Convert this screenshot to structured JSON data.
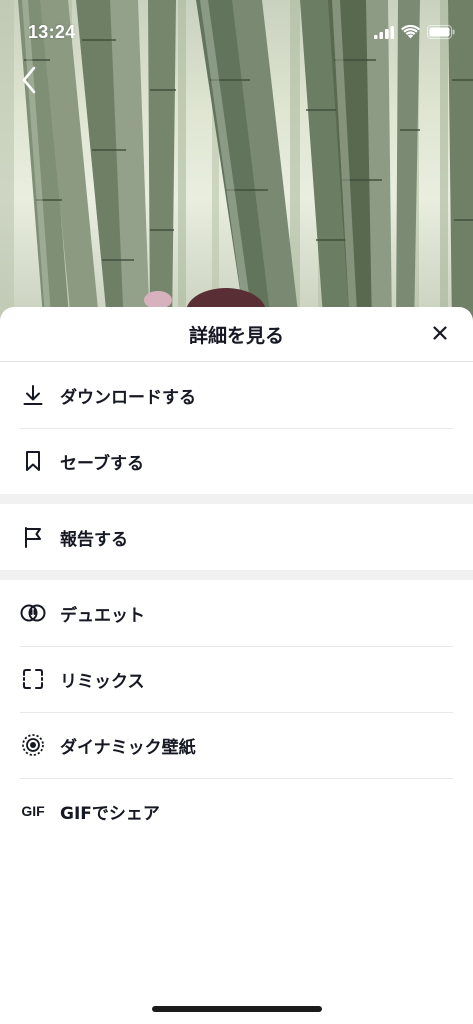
{
  "status_bar": {
    "time": "13:24",
    "icons": [
      "cellular-signal-icon",
      "wifi-icon",
      "battery-icon"
    ]
  },
  "photo": {
    "description_icon": "bamboo-grove-photo"
  },
  "nav": {
    "back_icon": "chevron-left-icon"
  },
  "sheet": {
    "title": "詳細を見る",
    "close_icon": "close-icon",
    "groups": [
      {
        "items": [
          {
            "label": "ダウンロードする",
            "icon": "download-icon"
          },
          {
            "label": "セーブする",
            "icon": "bookmark-icon"
          }
        ]
      },
      {
        "items": [
          {
            "label": "報告する",
            "icon": "flag-icon"
          }
        ]
      },
      {
        "items": [
          {
            "label": "デュエット",
            "icon": "duet-icon"
          },
          {
            "label": "リミックス",
            "icon": "remix-icon"
          },
          {
            "label": "ダイナミック壁紙",
            "icon": "live-wallpaper-icon"
          },
          {
            "label": "GIFでシェア",
            "icon": "gif-icon",
            "icon_text": "GIF"
          }
        ]
      }
    ]
  },
  "colors": {
    "text_primary": "#161823",
    "divider": "#e8e8e8",
    "group_separator": "#f1f1f2"
  }
}
